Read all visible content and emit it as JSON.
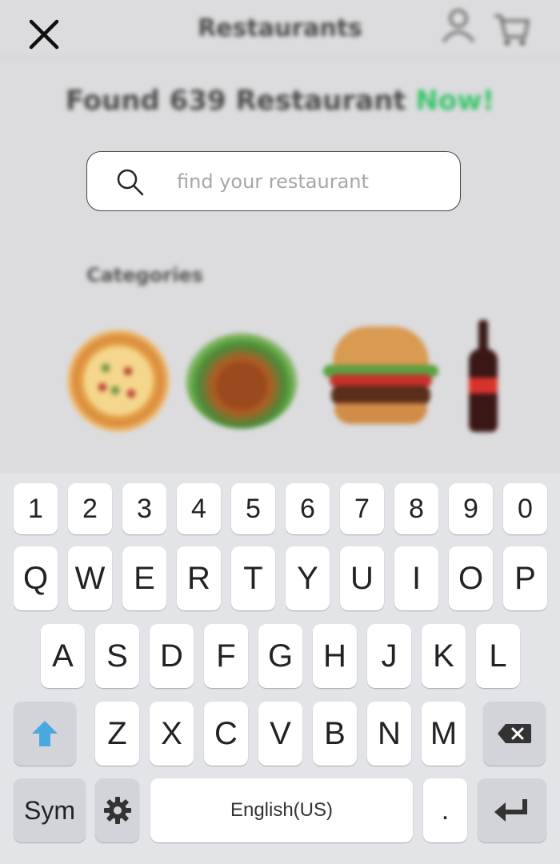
{
  "header": {
    "title": "Restaurants",
    "close_icon": "close-icon",
    "user_icon": "user-icon",
    "cart_icon": "cart-icon"
  },
  "summary": {
    "prefix": "Found 639 Restaurant",
    "accent": "Now!",
    "accent_color": "#38c46a"
  },
  "search": {
    "placeholder": "find your restaurant",
    "value": "",
    "icon": "search-icon"
  },
  "categories": {
    "title": "Categories",
    "items": [
      {
        "name": "pizza"
      },
      {
        "name": "chicken"
      },
      {
        "name": "burger"
      },
      {
        "name": "drinks"
      }
    ]
  },
  "keyboard": {
    "row_numbers": [
      "1",
      "2",
      "3",
      "4",
      "5",
      "6",
      "7",
      "8",
      "9",
      "0"
    ],
    "row_q": [
      "Q",
      "W",
      "E",
      "R",
      "T",
      "Y",
      "U",
      "I",
      "O",
      "P"
    ],
    "row_a": [
      "A",
      "S",
      "D",
      "F",
      "G",
      "H",
      "J",
      "K",
      "L"
    ],
    "row_z": [
      "Z",
      "X",
      "C",
      "V",
      "B",
      "N",
      "M"
    ],
    "shift_icon": "shift-arrow-icon",
    "shift_color": "#4aa8e0",
    "backspace_icon": "backspace-icon",
    "sym_label": "Sym",
    "settings_icon": "gear-icon",
    "space_label": "English(US)",
    "period_label": ".",
    "enter_icon": "enter-icon"
  }
}
